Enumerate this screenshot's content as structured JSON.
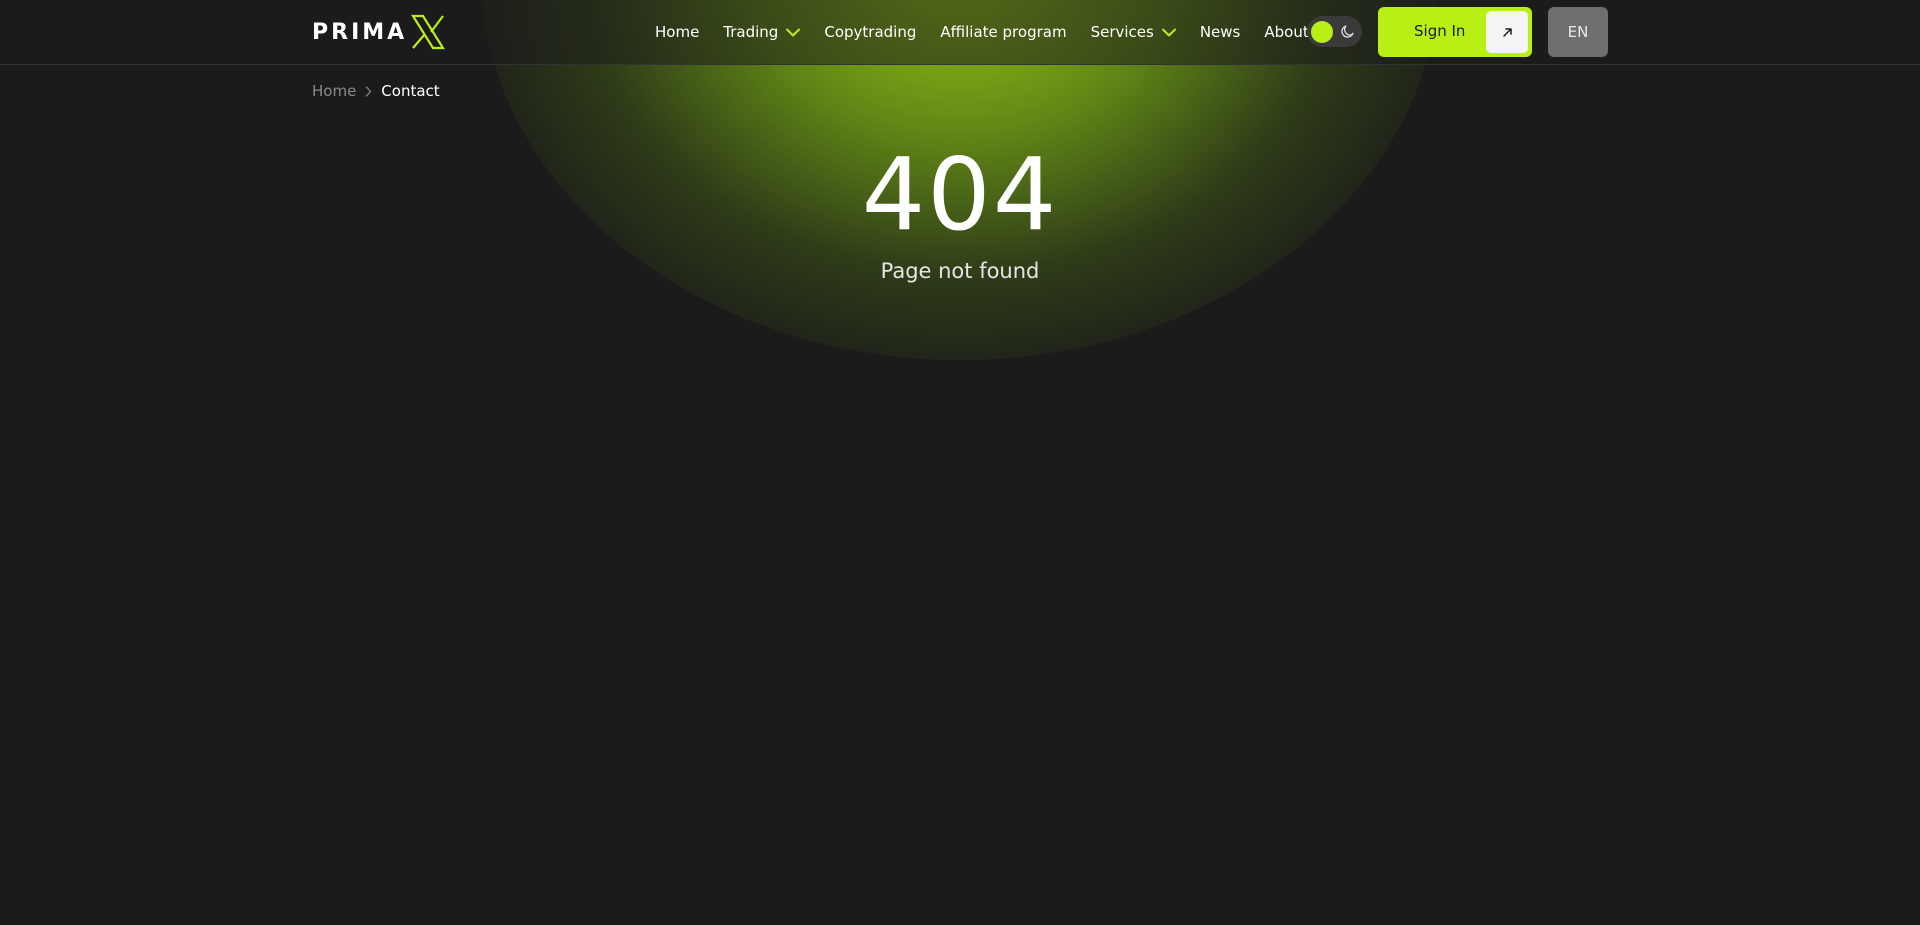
{
  "brand": {
    "logo_text": "PRIMA",
    "logo_mark": "X",
    "accent_color": "#b8f016"
  },
  "nav": {
    "items": [
      {
        "label": "Home",
        "has_dropdown": false
      },
      {
        "label": "Trading",
        "has_dropdown": true
      },
      {
        "label": "Copytrading",
        "has_dropdown": false
      },
      {
        "label": "Affiliate program",
        "has_dropdown": false
      },
      {
        "label": "Services",
        "has_dropdown": true
      },
      {
        "label": "News",
        "has_dropdown": false
      },
      {
        "label": "About",
        "has_dropdown": false
      }
    ]
  },
  "header": {
    "theme_toggle_icon": "moon-icon",
    "signin_label": "Sign In",
    "signin_icon": "arrow-up-right-icon",
    "language": "EN"
  },
  "breadcrumb": {
    "home": "Home",
    "current": "Contact"
  },
  "error": {
    "code": "404",
    "message": "Page not found"
  },
  "colors": {
    "background": "#1b1b1b",
    "accent": "#b8f016",
    "language_button": "#6e6e6e"
  }
}
